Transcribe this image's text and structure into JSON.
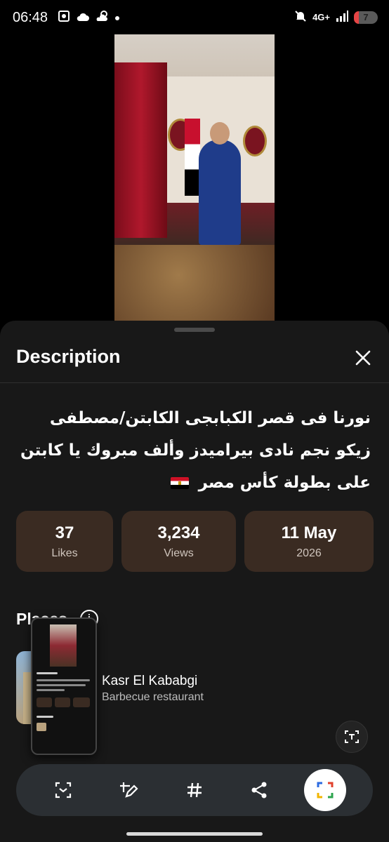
{
  "status_bar": {
    "time": "06:48",
    "network": "4G+",
    "battery": "7",
    "icons": [
      "screenshot-icon",
      "cloud-icon",
      "weather-icon",
      "dot-icon",
      "mute-icon",
      "signal-icon",
      "battery-icon"
    ]
  },
  "video": {
    "description": "dinner event video thumbnail"
  },
  "sheet": {
    "title": "Description",
    "description": "نورنا فى قصر الكبابجى الكابتن/مصطفى زيكو نجم نادى بيراميدز وألف مبروك يا كابتن على بطولة كأس مصر",
    "stats": [
      {
        "value": "37",
        "label": "Likes"
      },
      {
        "value": "3,234",
        "label": "Views"
      },
      {
        "value": "11 May",
        "label": "2026"
      }
    ],
    "places_title": "Places",
    "place": {
      "name": "Kasr El Kababgi",
      "type": "Barbecue restaurant"
    }
  },
  "toolbar": {
    "items": [
      "scan-icon",
      "edit-icon",
      "hashtag-icon",
      "share-icon",
      "lens-icon"
    ],
    "active": "lens-icon"
  },
  "colors": {
    "background": "#000000",
    "sheet": "#181818",
    "stat_card": "#3a2b22",
    "toolbar": "#2b2f33"
  }
}
